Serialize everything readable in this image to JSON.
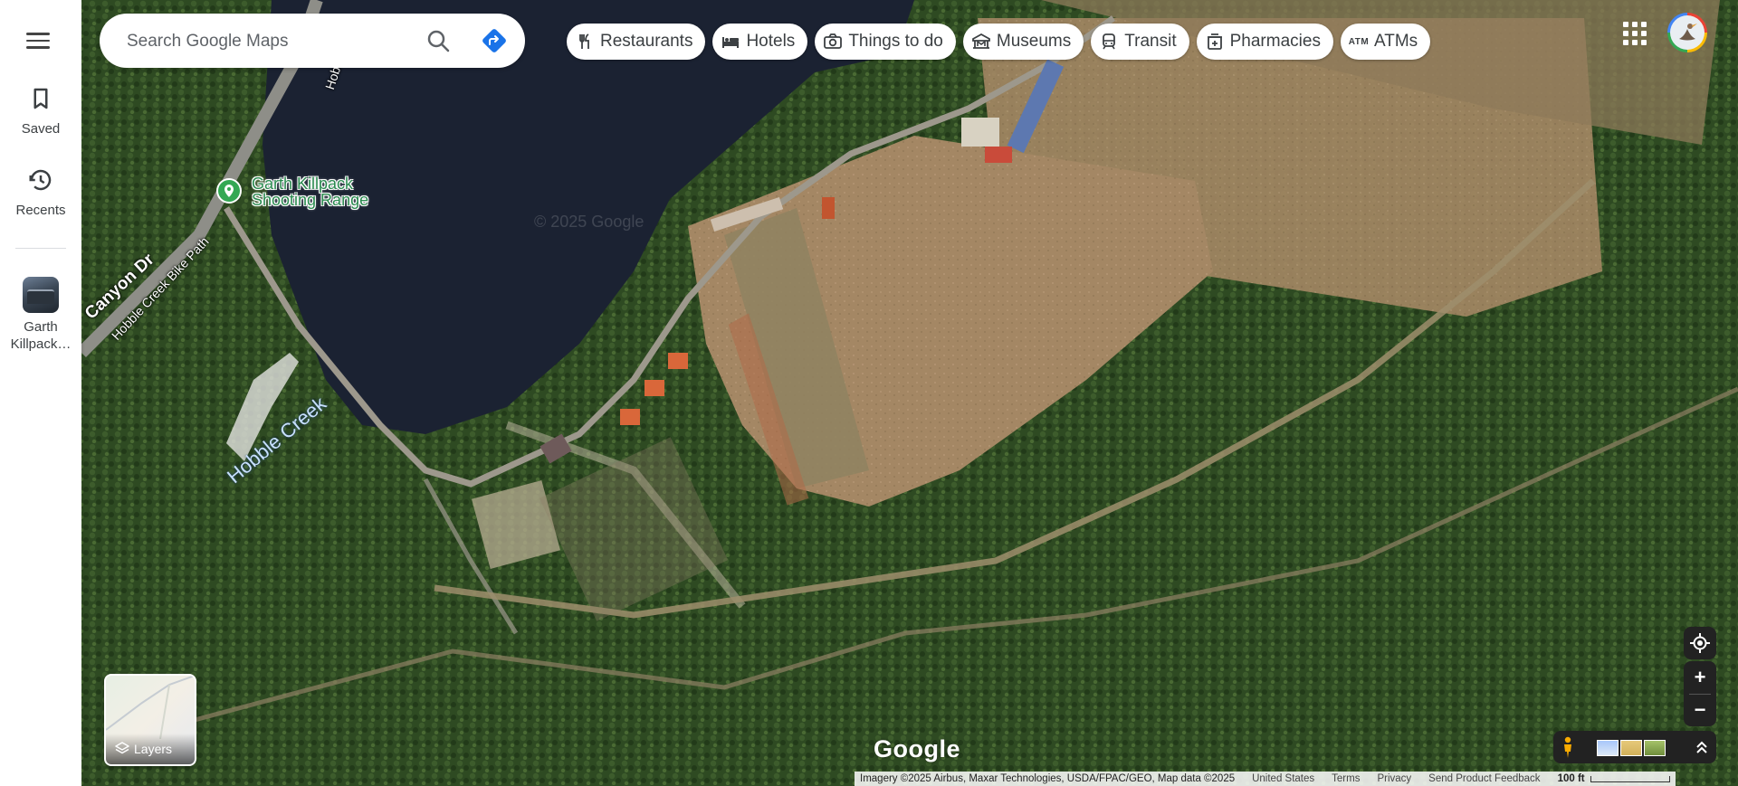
{
  "search": {
    "placeholder": "Search Google Maps"
  },
  "rail": {
    "saved_label": "Saved",
    "recents_label": "Recents",
    "recent_place_label": "Garth Killpack…"
  },
  "chips": [
    {
      "label": "Restaurants",
      "icon": "fork-knife-icon"
    },
    {
      "label": "Hotels",
      "icon": "bed-icon"
    },
    {
      "label": "Things to do",
      "icon": "camera-icon"
    },
    {
      "label": "Museums",
      "icon": "museum-icon"
    },
    {
      "label": "Transit",
      "icon": "train-icon"
    },
    {
      "label": "Pharmacies",
      "icon": "pharmacy-icon"
    },
    {
      "label": "ATMs",
      "icon": "atm-icon"
    }
  ],
  "map": {
    "place_label": "Garth Killpack Shooting Range",
    "road_label_1": "Canyon Dr",
    "road_label_2": "Hobble Creek Bike Path",
    "road_label_3": "Hobble",
    "water_label": "Hobble Creek",
    "watermark": "© 2025 Google",
    "layers_label": "Layers",
    "logo_text": "Google"
  },
  "footer": {
    "attribution": "Imagery ©2025 Airbus, Maxar Technologies, USDA/FPAC/GEO, Map data ©2025",
    "region": "United States",
    "terms": "Terms",
    "privacy": "Privacy",
    "feedback": "Send Product Feedback",
    "scale": "100 ft"
  },
  "colors": {
    "place_pin": "#34a853",
    "directions_blue": "#1a73e8",
    "water": "#1c2438",
    "forest": "#2f4a24",
    "field": "#a88a66"
  }
}
